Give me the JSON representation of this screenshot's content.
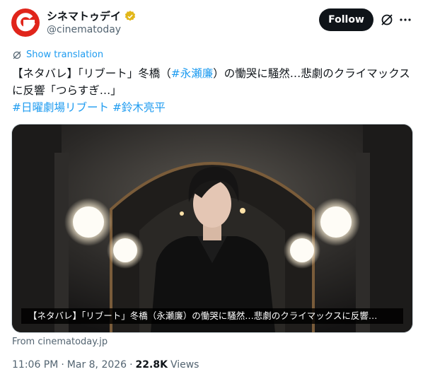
{
  "account": {
    "display_name": "シネマトゥデイ",
    "handle": "@cinematoday",
    "verified_color": "#e2b719",
    "avatar_color": "#e0251b"
  },
  "actions": {
    "follow_label": "Follow",
    "grok_icon": "grok-slash-icon",
    "more_icon": "more-dots-icon"
  },
  "translate": {
    "label": "Show translation"
  },
  "tweet": {
    "part1": "【ネタバレ】「リブート」冬橋（",
    "hashtag1": "#永瀬廉",
    "part2": "）の慟哭に騒然…悲劇のクライマックスに反響「つらすぎ…」",
    "hashtag2": "#日曜劇場リブート",
    "hashtag3": "#鈴木亮平"
  },
  "media": {
    "caption": "【ネタバレ】「リブート」冬橋（永瀬廉）の慟哭に騒然…悲劇のクライマックスに反響…"
  },
  "source": {
    "label": "From cinematoday.jp"
  },
  "meta": {
    "time": "11:06 PM",
    "sep1": "·",
    "date": "Mar 8, 2026",
    "sep2": "·",
    "views_count": "22.8K",
    "views_label": "Views"
  },
  "colors": {
    "link": "#1d9bf0",
    "text": "#0f1419",
    "muted": "#536471"
  }
}
